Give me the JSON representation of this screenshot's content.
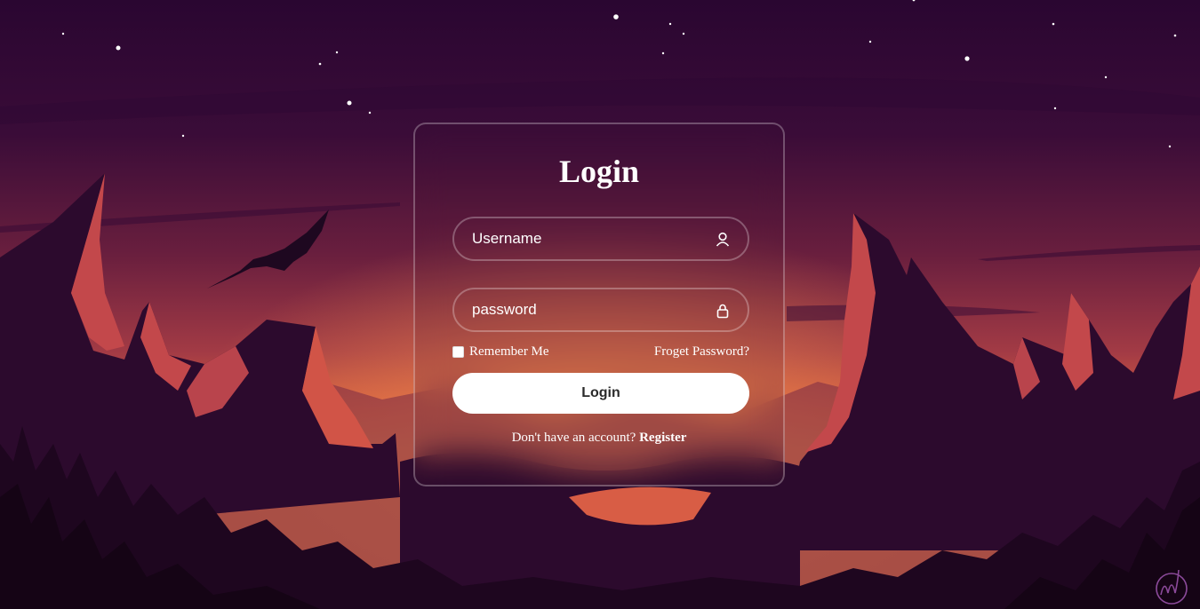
{
  "login_form": {
    "title": "Login",
    "username_placeholder": "Username",
    "password_placeholder": "password",
    "remember_label": "Remember Me",
    "forgot_label": "Froget Password?",
    "login_button_label": "Login",
    "register_prompt": "Don't have an account? ",
    "register_label": "Register",
    "username_icon": "user-icon",
    "password_icon": "lock-icon"
  },
  "colors": {
    "sky_top": "#2b0830",
    "glow": "#e4693f",
    "mountain_red": "#c54a4b",
    "mountain_dark": "#2a0a2b",
    "button_bg": "#ffffff",
    "button_text": "#2a2a2a"
  }
}
